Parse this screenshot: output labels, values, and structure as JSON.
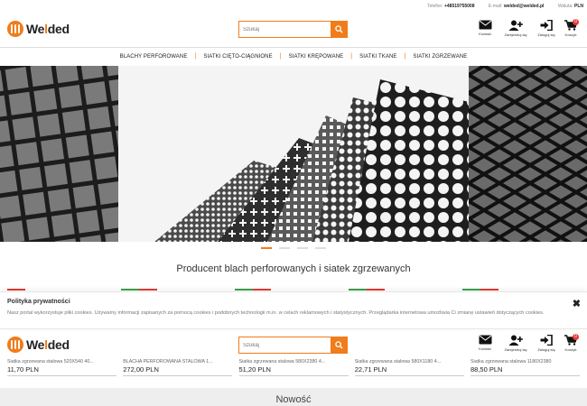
{
  "topbar": {
    "phone_label": "Telefon:",
    "phone": "+48519755008",
    "email_label": "E-mail:",
    "email": "welded@welded.pl",
    "currency_label": "Waluta:",
    "currency": "PLN"
  },
  "brand": {
    "name_a": "We",
    "name_b": "l",
    "name_c": "ded"
  },
  "search": {
    "placeholder": "Szukaj"
  },
  "tools": {
    "contact": "Kontakt",
    "register": "Zarejestruj się",
    "login": "Zaloguj się",
    "cart": "Koszyk",
    "cart_count": "0"
  },
  "nav": [
    "BLACHY PERFOROWANE",
    "SIATKI CIĘTO-CIĄGNIONE",
    "SIATKI KRĘPOWANE",
    "SIATKI TKANE",
    "SIATKI ZGRZEWANE"
  ],
  "headline": "Producent blach perforowanych i siatek zgrzewanych",
  "cookie": {
    "title": "Polityka prywatności",
    "text": "Nasz portal wykorzystuje pliki cookies. Używamy informacji zapisanych za pomocą cookies i podobnych technologii m.in. w celach reklamowych i statystycznych. Przeglądarka internetowa umożliwia Ci zmianę ustawień dotyczących cookies.",
    "close": "✖"
  },
  "products": [
    {
      "name": "Siatka zgrzewana stalowa 520X540 40...",
      "price": "11,70 PLN"
    },
    {
      "name": "BLACHA PERFOROWANA STALOWA 1...",
      "price": "272,00 PLN"
    },
    {
      "name": "Siatka zgrzewana stalowa 580X2380 4...",
      "price": "51,20 PLN"
    },
    {
      "name": "Siatka zgrzewana stalowa 580X1180 4...",
      "price": "22,71 PLN"
    },
    {
      "name": "Siatka zgrzewana stalowa 1180X2380",
      "price": "88,50 PLN"
    }
  ],
  "section_title": "Nowość",
  "colors": {
    "accent": "#f07c1a",
    "badge": "#e53935"
  }
}
